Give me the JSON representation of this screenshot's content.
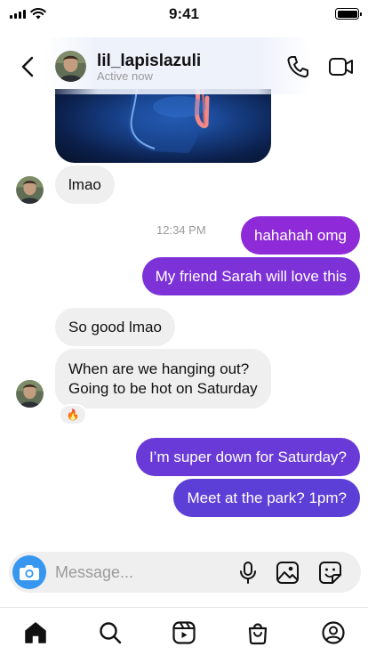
{
  "status_bar": {
    "time": "9:41"
  },
  "header": {
    "username": "lil_lapislazuli",
    "presence": "Active now"
  },
  "messages": {
    "m1": "lmao",
    "timestamp": "12:34 PM",
    "m2": "hahahah omg",
    "m3": "My friend Sarah will love this",
    "m4": "So good lmao",
    "m5_line1": "When are we hanging out?",
    "m5_line2": "Going to be hot on Saturday",
    "m5_reaction": "🔥",
    "m6": "I’m super down for Saturday?",
    "m7": "Meet at the park? 1pm?"
  },
  "composer": {
    "placeholder": "Message..."
  },
  "colors": {
    "accent_blue": "#3797f0",
    "outgoing_bubble_top": "#8f2ad8",
    "outgoing_bubble_bottom": "#5c3fd6",
    "incoming_bubble": "#efefef"
  },
  "icons": {
    "header": [
      "back-arrow-icon",
      "phone-icon",
      "video-camera-icon"
    ],
    "composer": [
      "camera-icon",
      "microphone-icon",
      "gallery-icon",
      "sticker-icon"
    ],
    "tab_bar": [
      "home-icon",
      "search-icon",
      "reels-icon",
      "shop-icon",
      "profile-icon"
    ]
  }
}
